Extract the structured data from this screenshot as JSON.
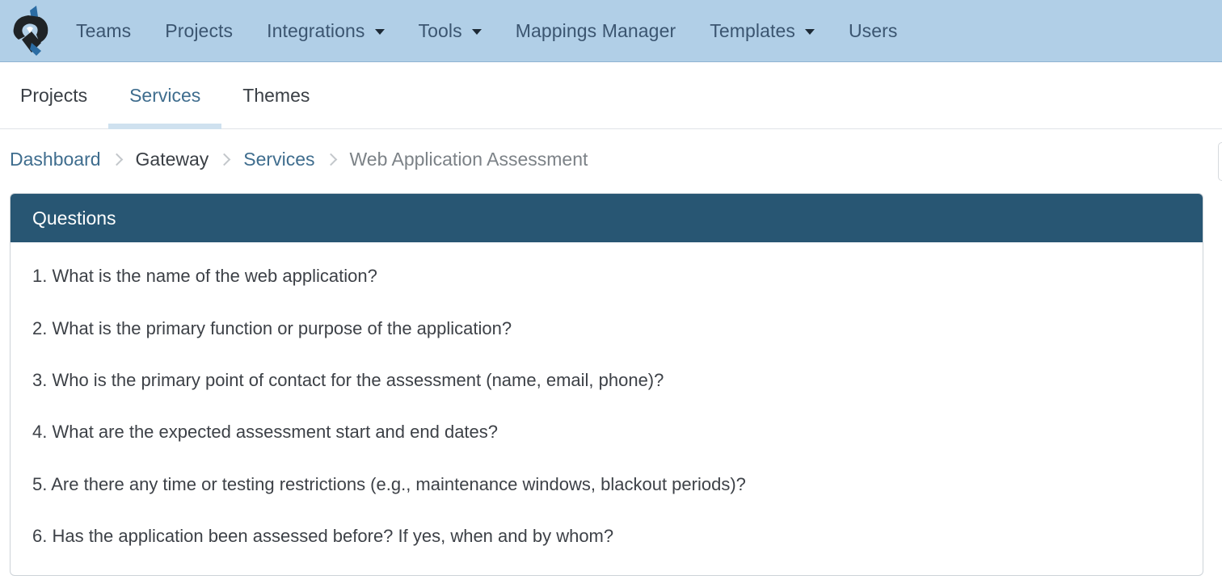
{
  "topnav": {
    "logo_icon": "wrench-logo-icon",
    "items": [
      {
        "label": "Teams",
        "dropdown": false
      },
      {
        "label": "Projects",
        "dropdown": false
      },
      {
        "label": "Integrations",
        "dropdown": true
      },
      {
        "label": "Tools",
        "dropdown": true
      },
      {
        "label": "Mappings Manager",
        "dropdown": false
      },
      {
        "label": "Templates",
        "dropdown": true
      },
      {
        "label": "Users",
        "dropdown": false
      }
    ]
  },
  "subnav": {
    "tabs": [
      {
        "label": "Projects",
        "active": false
      },
      {
        "label": "Services",
        "active": true
      },
      {
        "label": "Themes",
        "active": false
      }
    ]
  },
  "breadcrumb": {
    "items": [
      "Dashboard",
      "Gateway",
      "Services",
      "Web Application Assessment"
    ]
  },
  "panel": {
    "title": "Questions",
    "questions": [
      "1. What is the name of the web application?",
      "2. What is the primary function or purpose of the application?",
      "3. Who is the primary point of contact for the assessment (name, email, phone)?",
      "4. What are the expected assessment start and end dates?",
      "5. Are there any time or testing restrictions (e.g., maintenance windows, blackout periods)?",
      "6. Has the application been assessed before? If yes, when and by whom?"
    ]
  },
  "colors": {
    "topnav_bg": "#b1cfe7",
    "panel_header_bg": "#285673",
    "link": "#3f6d8e"
  }
}
